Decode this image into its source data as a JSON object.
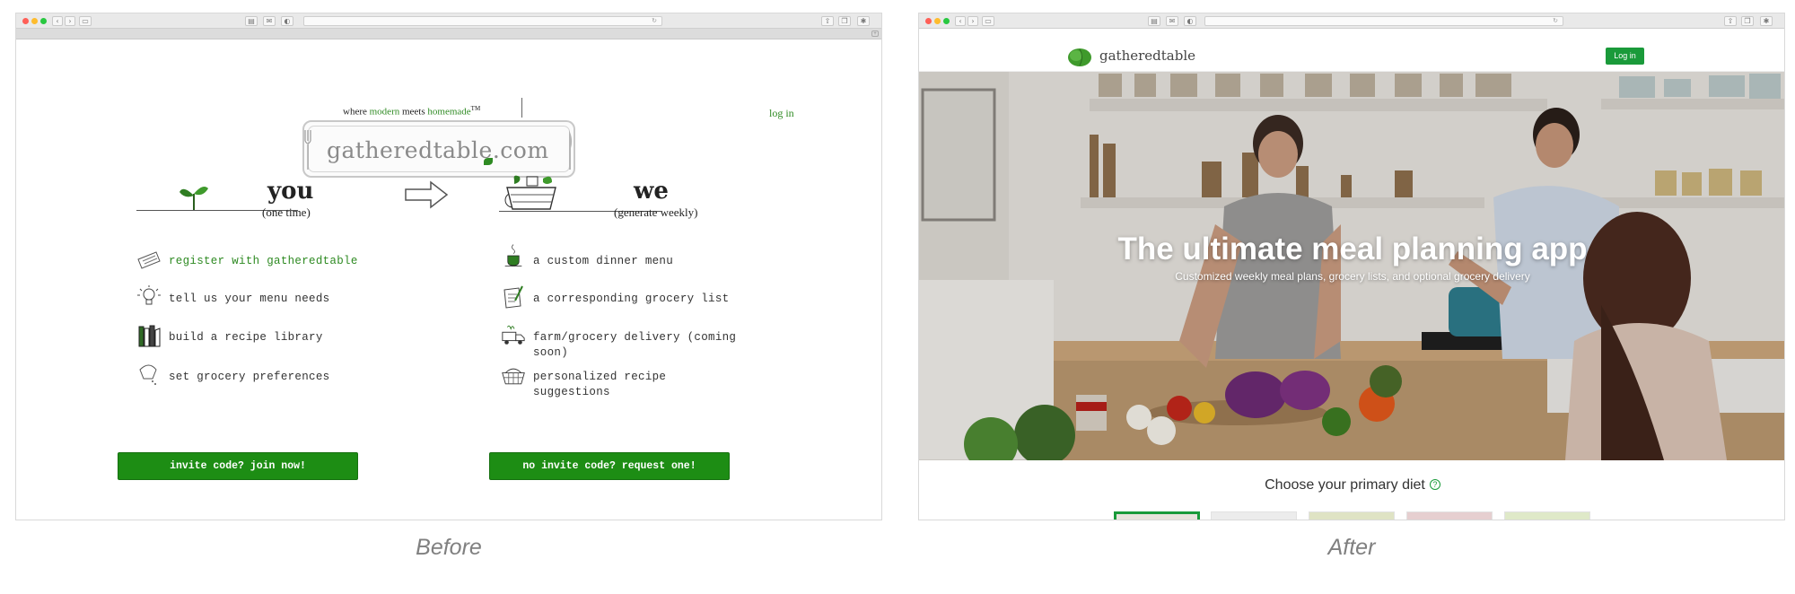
{
  "before": {
    "tagline": {
      "prefix": "where ",
      "word_modern": "modern",
      "middle": " meets ",
      "word_homemade": "homemade",
      "trademark": "TM"
    },
    "login_link": "log in",
    "logo_text": "gatheredtable.com",
    "you": {
      "heading": "you",
      "subheading": "(one time)"
    },
    "we": {
      "heading": "we",
      "subheading": "(generate weekly)"
    },
    "you_steps": [
      {
        "label": "register with gatheredtable",
        "icon": "keyboard-icon"
      },
      {
        "label": "tell us your menu needs",
        "icon": "lightbulb-icon"
      },
      {
        "label": "build a recipe library",
        "icon": "books-icon"
      },
      {
        "label": "set grocery preferences",
        "icon": "salt-shaker-icon"
      }
    ],
    "we_steps": [
      {
        "label": "a custom dinner menu",
        "icon": "steaming-cup-icon"
      },
      {
        "label": "a corresponding grocery list",
        "icon": "notepad-icon"
      },
      {
        "label_line1": "farm/grocery delivery (coming",
        "label_line2": "soon)",
        "icon": "delivery-truck-icon"
      },
      {
        "label_line1": "personalized recipe",
        "label_line2": "suggestions",
        "icon": "basket-icon"
      }
    ],
    "cta_join": "invite code? join now!",
    "cta_request": "no invite code? request one!",
    "colors": {
      "accent_green": "#2e8a22",
      "button_green": "#1d8d14"
    }
  },
  "after": {
    "brand": "gatheredtable",
    "login_button": "Log in",
    "hero_title": "The ultimate meal planning app",
    "hero_subtitle": "Customized weekly meal plans, grocery lists, and optional grocery delivery",
    "diet_title": "Choose your primary diet",
    "diet_info_icon": "?",
    "diet_cards": [
      {
        "selected": true,
        "tone": "#e8e3dc"
      },
      {
        "selected": false,
        "tone": "#ececec"
      },
      {
        "selected": false,
        "tone": "#dfe3c4"
      },
      {
        "selected": false,
        "tone": "#e6cfd0"
      },
      {
        "selected": false,
        "tone": "#dfe9c8"
      }
    ],
    "colors": {
      "accent_green": "#1a9a3a"
    }
  },
  "captions": {
    "before": "Before",
    "after": "After"
  }
}
